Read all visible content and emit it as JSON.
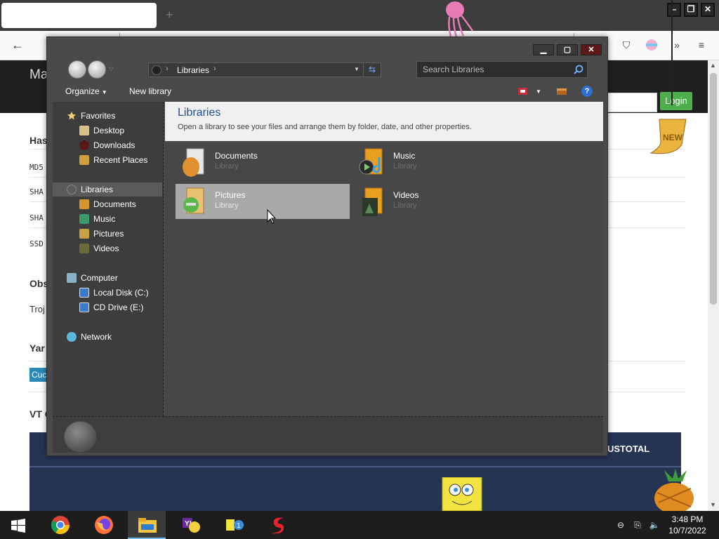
{
  "browser": {
    "new_tab": "+",
    "win_minimize": "–",
    "win_restore": "❐",
    "win_close": "✕"
  },
  "page": {
    "brand": "Ma",
    "login_button": "Login",
    "heading_1": "Has",
    "hash_1": "MD5",
    "hash_2": "SHA",
    "hash_3": "SHA",
    "hash_4": "SSD",
    "heading_2": "Obs",
    "detection": "Troj",
    "heading_3": "Yar",
    "tag": "Cuc",
    "heading_4": "VT C",
    "vt_label": "USTOTAL",
    "new_badge": "NEW"
  },
  "explorer": {
    "breadcrumb": "Libraries",
    "search_placeholder": "Search Libraries",
    "organize": "Organize",
    "new_library": "New library",
    "help": "?",
    "nav": {
      "favorites": "Favorites",
      "desktop": "Desktop",
      "downloads": "Downloads",
      "recent": "Recent Places",
      "libraries": "Libraries",
      "documents": "Documents",
      "music": "Music",
      "pictures": "Pictures",
      "videos": "Videos",
      "computer": "Computer",
      "local_disk": "Local Disk (C:)",
      "cd_drive": "CD Drive (E:)",
      "network": "Network"
    },
    "header_title": "Libraries",
    "header_subtitle": "Open a library to see your files and arrange them by folder, date, and other properties.",
    "tiles": [
      {
        "name": "Documents",
        "type": "Library"
      },
      {
        "name": "Music",
        "type": "Library"
      },
      {
        "name": "Pictures",
        "type": "Library"
      },
      {
        "name": "Videos",
        "type": "Library"
      }
    ]
  },
  "taskbar": {
    "time": "3:48 PM",
    "date": "10/7/2022"
  },
  "colors": {
    "accent_title": "#1f4f8f",
    "login_green": "#4cae4c",
    "taskbar": "#1d1d1d"
  }
}
